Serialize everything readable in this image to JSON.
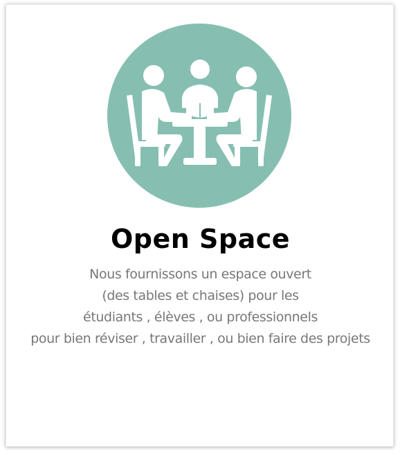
{
  "card": {
    "title": "Open Space",
    "description_lines": [
      "Nous fournissons un espace ouvert",
      "(des tables et chaises) pour les",
      "étudiants , élèves , ou professionnels",
      "pour bien réviser , travailler , ou bien faire des projets"
    ],
    "icon": "people-meeting-at-table-icon"
  },
  "colors": {
    "icon_background": "#86bfb1",
    "icon_foreground": "#ffffff",
    "title": "#000000",
    "description": "#777777"
  }
}
